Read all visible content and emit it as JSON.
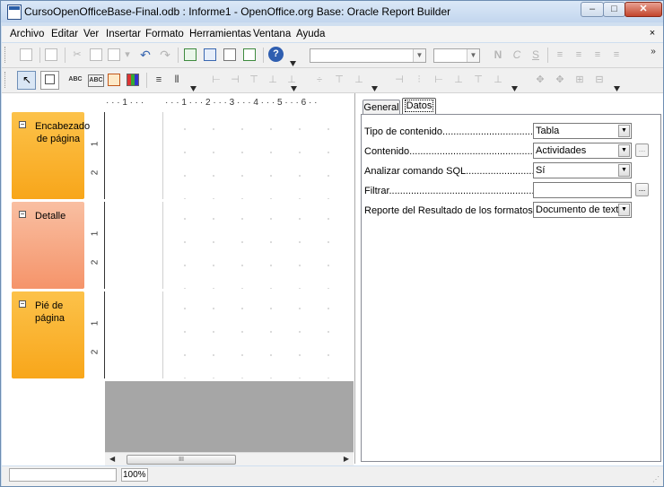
{
  "window": {
    "title": "CursoOpenOfficeBase-Final.odb : Informe1 - OpenOffice.org Base: Oracle Report Builder",
    "min_label": "–",
    "max_label": "□",
    "close_label": "✕"
  },
  "menubar": {
    "items": [
      {
        "label": "Archivo"
      },
      {
        "label": "Editar"
      },
      {
        "label": "Ver"
      },
      {
        "label": "Insertar"
      },
      {
        "label": "Formato"
      },
      {
        "label": "Herramientas"
      },
      {
        "label": "Ventana"
      },
      {
        "label": "Ayuda"
      }
    ],
    "close_label": "×"
  },
  "toolbar": {
    "font_name_value": "",
    "font_size_value": "",
    "bold_label": "N",
    "italic_label": "C",
    "underline_label": "S",
    "help_label": "?",
    "abc1": "ABC",
    "abc2": "ABC"
  },
  "ruler": {
    "h_ticks": [
      "· · · 1 · · · ",
      "· · · 1 · · · 2 · · · 3 · · · 4 · · · 5 · · · 6 · ·"
    ],
    "v_nums": [
      "1",
      "2"
    ]
  },
  "sections": [
    {
      "label": "Encabezado de página",
      "color_top": "#fcc24a",
      "color_bottom": "#f8a61a"
    },
    {
      "label": "Detalle",
      "color_top": "#f9bfa2",
      "color_bottom": "#f5946a"
    },
    {
      "label": "Pié de página",
      "color_top": "#fcc24a",
      "color_bottom": "#f8a61a"
    }
  ],
  "scroll": {
    "thumb_label": "III",
    "left_arrow": "◀",
    "right_arrow": "▶"
  },
  "properties": {
    "tabs": [
      {
        "label": "General"
      },
      {
        "label": "Datos"
      }
    ],
    "rows": [
      {
        "label": "Tipo de contenido......................................",
        "value": "Tabla",
        "has_arrow": true,
        "has_dots": false
      },
      {
        "label": "Contenido...................................................",
        "value": "Actividades",
        "has_arrow": true,
        "has_dots": true
      },
      {
        "label": "Analizar comando SQL................................",
        "value": "Sí",
        "has_arrow": true,
        "has_dots": false
      },
      {
        "label": "Filtrar..........................................................",
        "value": "",
        "has_arrow": false,
        "has_dots": true
      },
      {
        "label": "Reporte del Resultado de los formatos.....",
        "value": "Documento de texto",
        "has_arrow": true,
        "has_dots": false
      }
    ],
    "arrow_glyph": "▼",
    "dots_label": "..."
  },
  "status": {
    "zoom": "100%"
  }
}
